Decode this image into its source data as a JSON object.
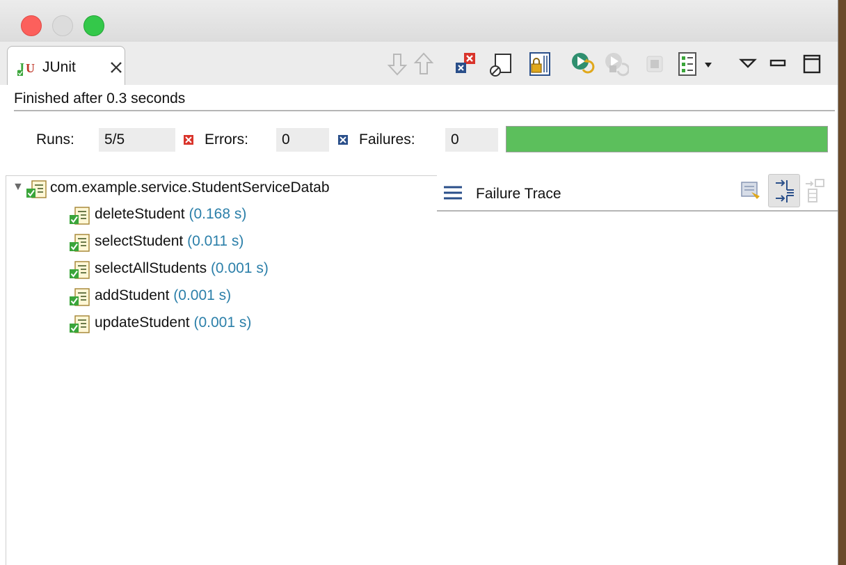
{
  "window": {
    "traffic_lights": [
      "close",
      "minimize",
      "maximize"
    ]
  },
  "tab": {
    "icon": "junit-icon",
    "label": "JUnit",
    "close_icon": "close-tab-icon"
  },
  "toolbar": {
    "icons": [
      "next-failure-icon",
      "previous-failure-icon",
      "show-failures-only-icon",
      "show-skipped-icon",
      "scroll-lock-icon",
      "rerun-test-icon",
      "rerun-failed-first-icon",
      "stop-icon",
      "test-run-history-icon",
      "history-dropdown-icon",
      "view-menu-icon",
      "minimize-view-icon",
      "maximize-view-icon"
    ]
  },
  "status": {
    "text": "Finished after 0.3 seconds"
  },
  "counters": {
    "runs_label": "Runs:",
    "runs_value": "5/5",
    "errors_label": "Errors:",
    "errors_value": "0",
    "failures_label": "Failures:",
    "failures_value": "0",
    "progress": 1.0,
    "progress_color": "#5cbf5c"
  },
  "tree": {
    "suite": "com.example.service.StudentServiceDatab",
    "tests": [
      {
        "name": "deleteStudent",
        "time": "(0.168 s)"
      },
      {
        "name": "selectStudent",
        "time": "(0.011 s)"
      },
      {
        "name": "selectAllStudents",
        "time": "(0.001 s)"
      },
      {
        "name": "addStudent",
        "time": "(0.001 s)"
      },
      {
        "name": "updateStudent",
        "time": "(0.001 s)"
      }
    ]
  },
  "trace": {
    "title": "Failure Trace",
    "buttons": [
      "compare-result-icon",
      "filter-stack-trace-icon",
      "copy-trace-icon"
    ]
  },
  "colors": {
    "timing_text": "#2b7fa9",
    "error_red": "#d9342b",
    "failure_blue": "#2a4f8a",
    "pass_green": "#3aa53a"
  }
}
